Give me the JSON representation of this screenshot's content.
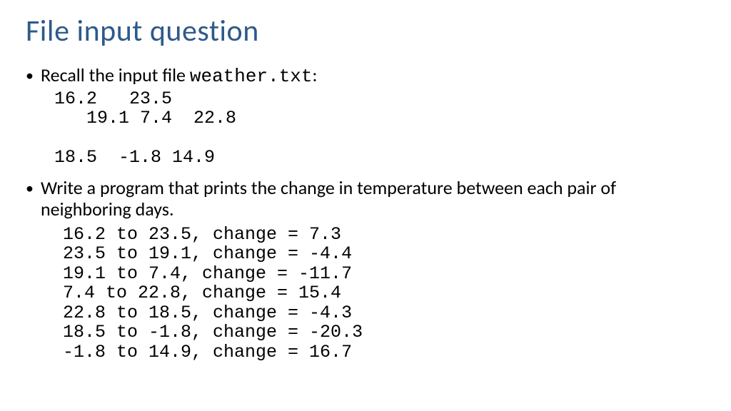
{
  "title": "File input question",
  "bullet1_prefix": "Recall the input file ",
  "bullet1_filename": "weather.txt",
  "bullet1_suffix": ":",
  "input_file_content": "16.2   23.5\n   19.1 7.4  22.8\n\n18.5  -1.8 14.9",
  "bullet2": "Write a program that prints the change in temperature between each pair of neighboring days.",
  "output_content": "16.2 to 23.5, change = 7.3\n23.5 to 19.1, change = -4.4\n19.1 to 7.4, change = -11.7\n7.4 to 22.8, change = 15.4\n22.8 to 18.5, change = -4.3\n18.5 to -1.8, change = -20.3\n-1.8 to 14.9, change = 16.7"
}
